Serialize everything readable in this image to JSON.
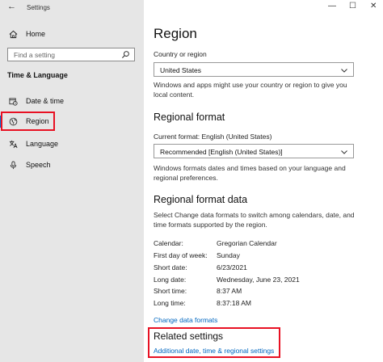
{
  "window": {
    "back_glyph": "←",
    "title": "Settings",
    "controls": {
      "minimize": "—",
      "maximize": "☐",
      "close": "✕"
    }
  },
  "sidebar": {
    "home": "Home",
    "search_placeholder": "Find a setting",
    "section": "Time & Language",
    "items": [
      {
        "label": "Date & time",
        "icon": "calendar-clock-icon"
      },
      {
        "label": "Region",
        "icon": "globe-icon",
        "selected": true
      },
      {
        "label": "Language",
        "icon": "language-icon"
      },
      {
        "label": "Speech",
        "icon": "microphone-icon"
      }
    ]
  },
  "main": {
    "title": "Region",
    "country_label": "Country or region",
    "country_value": "United States",
    "country_desc": "Windows and apps might use your country or region to give you local content.",
    "format_heading": "Regional format",
    "current_format": "Current format: English (United States)",
    "format_value": "Recommended [English (United States)]",
    "format_desc": "Windows formats dates and times based on your language and regional preferences.",
    "data_heading": "Regional format data",
    "data_desc": "Select Change data formats to switch among calendars, date, and time formats supported by the region.",
    "formats": [
      {
        "key": "Calendar:",
        "value": "Gregorian Calendar"
      },
      {
        "key": "First day of week:",
        "value": "Sunday"
      },
      {
        "key": "Short date:",
        "value": "6/23/2021"
      },
      {
        "key": "Long date:",
        "value": "Wednesday, June 23, 2021"
      },
      {
        "key": "Short time:",
        "value": "8:37 AM"
      },
      {
        "key": "Long time:",
        "value": "8:37:18 AM"
      }
    ],
    "change_link": "Change data formats",
    "related_heading": "Related settings",
    "related_link": "Additional date, time & regional settings"
  },
  "colors": {
    "accent": "#0078d7",
    "link": "#0067c0",
    "highlight": "#e81123",
    "sidebar_bg": "#e6e6e6"
  }
}
